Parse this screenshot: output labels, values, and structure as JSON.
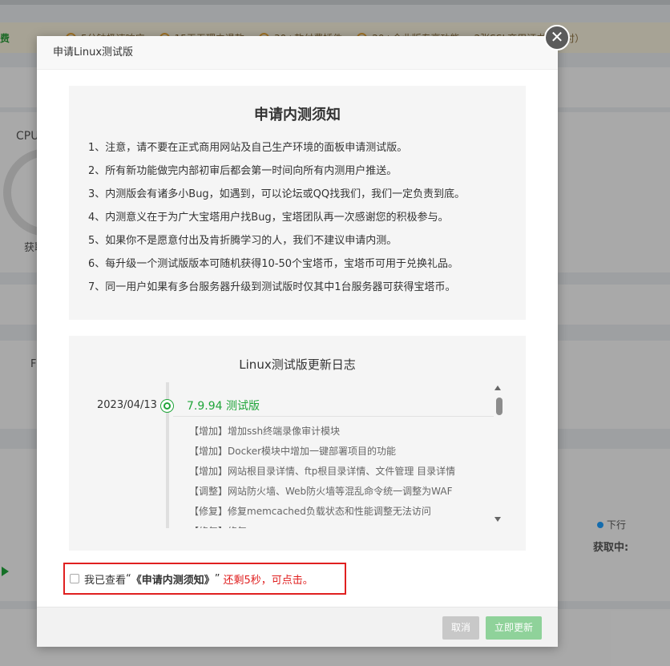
{
  "background": {
    "notice_first": "费",
    "notices": [
      "5分钟极速响应",
      "15天无理由退款",
      "30+款付费插件",
      "20+企业版专享功能",
      "2张SSL商用证书（年付）"
    ],
    "cpu_label": "CPU",
    "cpu_status": "获取",
    "f_label": "F",
    "download_label": "下行",
    "fetching_label": "获取中:"
  },
  "modal": {
    "title": "申请Linux测试版",
    "close_glyph": "✕",
    "notice": {
      "title": "申请内测须知",
      "items": [
        "1、注意，请不要在正式商用网站及自己生产环境的面板申请测试版。",
        "2、所有新功能做完内部初审后都会第一时间向所有内测用户推送。",
        "3、内测版会有诸多小Bug，如遇到，可以论坛或QQ找我们，我们一定负责到底。",
        "4、内测意义在于为广大宝塔用户找Bug，宝塔团队再一次感谢您的积极参与。",
        "5、如果你不是愿意付出及肯折腾学习的人，我们不建议申请内测。",
        "6、每升级一个测试版版本可随机获得10-50个宝塔币，宝塔币可用于兑换礼品。",
        "7、同一用户如果有多台服务器升级到测试版时仅其中1台服务器可获得宝塔币。"
      ]
    },
    "changelog": {
      "title": "Linux测试版更新日志",
      "date": "2023/04/13",
      "version": "7.9.94 测试版",
      "items": [
        "【增加】增加ssh终端录像审计模块",
        "【增加】Docker模块中增加一键部署项目的功能",
        "【增加】网站根目录详情、ftp根目录详情、文件管理 目录详情",
        "【调整】网站防火墙、Web防火墙等混乱命令统一调整为WAF",
        "【修复】修复memcached负载状态和性能调整无法访问",
        "【修复】修复..."
      ]
    },
    "confirm": {
      "prefix": "我已查看",
      "open_quote": "“",
      "doc": "《申请内测须知》",
      "close_quote": "”",
      "countdown": "还剩5秒，可点击。"
    },
    "buttons": {
      "cancel": "取消",
      "update": "立即更新"
    }
  }
}
